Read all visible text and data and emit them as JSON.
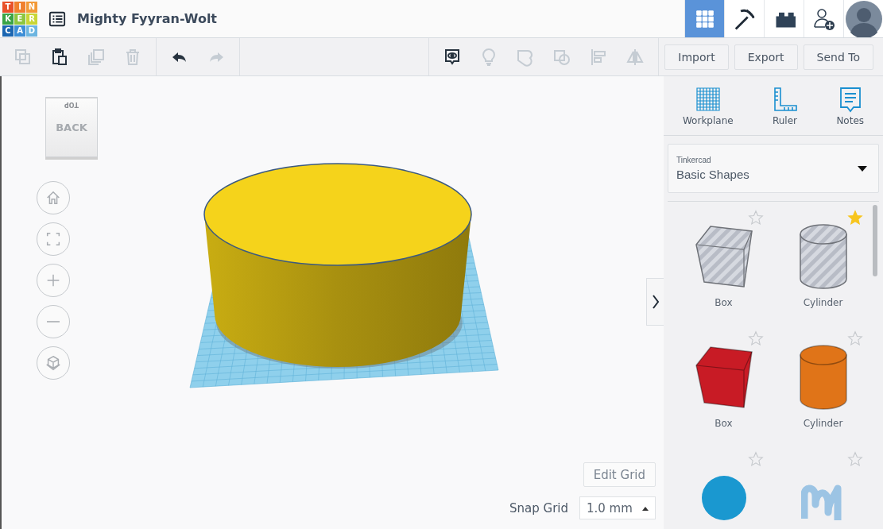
{
  "logo": {
    "letters": [
      {
        "char": "T",
        "color": "#e8512a"
      },
      {
        "char": "I",
        "color": "#f0802e"
      },
      {
        "char": "N",
        "color": "#f29a38"
      },
      {
        "char": "K",
        "color": "#3aa346"
      },
      {
        "char": "E",
        "color": "#8dc63f"
      },
      {
        "char": "R",
        "color": "#c9d636"
      },
      {
        "char": "C",
        "color": "#1b66b1"
      },
      {
        "char": "A",
        "color": "#3d8ed6"
      },
      {
        "char": "D",
        "color": "#6cb5e0"
      }
    ]
  },
  "title": "Mighty Fyyran-Wolt",
  "header_nav": [
    {
      "kind": "grid",
      "selected": true
    },
    {
      "kind": "pickaxe",
      "selected": false
    },
    {
      "kind": "brick",
      "selected": false
    },
    {
      "kind": "add-user",
      "selected": false
    },
    {
      "kind": "avatar",
      "selected": false
    }
  ],
  "edit_tools": [
    {
      "kind": "copy",
      "disabled": true
    },
    {
      "kind": "paste",
      "disabled": false
    },
    {
      "kind": "duplicate",
      "disabled": true
    },
    {
      "kind": "delete",
      "disabled": true
    }
  ],
  "history_tools": [
    {
      "kind": "undo",
      "disabled": false
    },
    {
      "kind": "redo",
      "disabled": true
    }
  ],
  "view_tools": [
    {
      "kind": "notes-toggle",
      "disabled": false
    },
    {
      "kind": "light",
      "disabled": true
    },
    {
      "kind": "group",
      "disabled": true
    },
    {
      "kind": "ungroup",
      "disabled": true
    },
    {
      "kind": "align",
      "disabled": true
    },
    {
      "kind": "mirror",
      "disabled": true
    }
  ],
  "actions": [
    "Import",
    "Export",
    "Send To"
  ],
  "view_cube": {
    "top": "TOP",
    "front": "BACK"
  },
  "nav_controls": [
    {
      "kind": "home"
    },
    {
      "kind": "fit"
    },
    {
      "kind": "zoom-in"
    },
    {
      "kind": "zoom-out"
    },
    {
      "kind": "perspective"
    }
  ],
  "edit_grid": "Edit Grid",
  "snap_grid": {
    "label": "Snap Grid",
    "value": "1.0 mm"
  },
  "panel_tools": [
    {
      "kind": "workplane",
      "label": "Workplane"
    },
    {
      "kind": "ruler",
      "label": "Ruler"
    },
    {
      "kind": "notes",
      "label": "Notes"
    }
  ],
  "library": {
    "category": "Tinkercad",
    "value": "Basic Shapes"
  },
  "shapes": [
    {
      "kind": "box",
      "hole": true,
      "color": "#b8bcc6",
      "label": "Box",
      "favorite": false
    },
    {
      "kind": "cylinder",
      "hole": true,
      "color": "#b8bcc6",
      "label": "Cylinder",
      "favorite": true
    },
    {
      "kind": "box",
      "hole": false,
      "color": "#c81b25",
      "label": "Box",
      "favorite": false
    },
    {
      "kind": "cylinder",
      "hole": false,
      "color": "#e07418",
      "label": "Cylinder",
      "favorite": false
    },
    {
      "kind": "sphere",
      "hole": false,
      "color": "#1a98d0",
      "favorite": false
    },
    {
      "kind": "scribble",
      "hole": false,
      "color": "#9cc4e4",
      "favorite": false
    }
  ]
}
